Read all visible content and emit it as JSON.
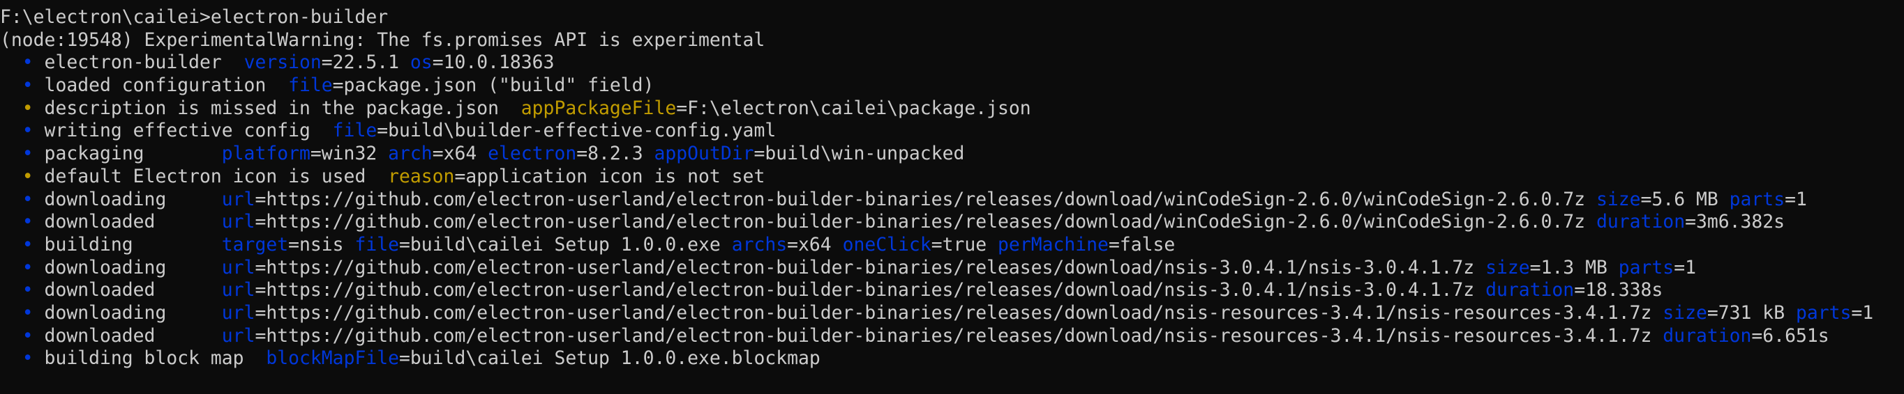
{
  "colors": {
    "background": "#0c0c0c",
    "fg": "#cccccc",
    "blue": "#0037da",
    "yellow": "#c19c00"
  },
  "terminal": {
    "lines": [
      [
        {
          "t": "F:\\electron\\cailei>electron-builder",
          "c": "fg"
        }
      ],
      [
        {
          "t": "(node:19548) ExperimentalWarning: The fs.promises API is experimental",
          "c": "fg"
        }
      ],
      [
        {
          "t": "  •",
          "c": "blue"
        },
        {
          "t": " electron-builder  ",
          "c": "fg"
        },
        {
          "t": "version",
          "c": "blue"
        },
        {
          "t": "=22.5.1 ",
          "c": "fg"
        },
        {
          "t": "os",
          "c": "blue"
        },
        {
          "t": "=10.0.18363",
          "c": "fg"
        }
      ],
      [
        {
          "t": "  •",
          "c": "blue"
        },
        {
          "t": " loaded configuration  ",
          "c": "fg"
        },
        {
          "t": "file",
          "c": "blue"
        },
        {
          "t": "=package.json (\"build\" field)",
          "c": "fg"
        }
      ],
      [
        {
          "t": "  •",
          "c": "yellow"
        },
        {
          "t": " description is missed in the package.json  ",
          "c": "fg"
        },
        {
          "t": "appPackageFile",
          "c": "yellow"
        },
        {
          "t": "=F:\\electron\\cailei\\package.json",
          "c": "fg"
        }
      ],
      [
        {
          "t": "  •",
          "c": "blue"
        },
        {
          "t": " writing effective config  ",
          "c": "fg"
        },
        {
          "t": "file",
          "c": "blue"
        },
        {
          "t": "=build\\builder-effective-config.yaml",
          "c": "fg"
        }
      ],
      [
        {
          "t": "  •",
          "c": "blue"
        },
        {
          "t": " packaging       ",
          "c": "fg"
        },
        {
          "t": "platform",
          "c": "blue"
        },
        {
          "t": "=win32 ",
          "c": "fg"
        },
        {
          "t": "arch",
          "c": "blue"
        },
        {
          "t": "=x64 ",
          "c": "fg"
        },
        {
          "t": "electron",
          "c": "blue"
        },
        {
          "t": "=8.2.3 ",
          "c": "fg"
        },
        {
          "t": "appOutDir",
          "c": "blue"
        },
        {
          "t": "=build\\win-unpacked",
          "c": "fg"
        }
      ],
      [
        {
          "t": "  •",
          "c": "yellow"
        },
        {
          "t": " default Electron icon is used  ",
          "c": "fg"
        },
        {
          "t": "reason",
          "c": "yellow"
        },
        {
          "t": "=application icon is not set",
          "c": "fg"
        }
      ],
      [
        {
          "t": "  •",
          "c": "blue"
        },
        {
          "t": " downloading     ",
          "c": "fg"
        },
        {
          "t": "url",
          "c": "blue"
        },
        {
          "t": "=https://github.com/electron-userland/electron-builder-binaries/releases/download/winCodeSign-2.6.0/winCodeSign-2.6.0.7z ",
          "c": "fg"
        },
        {
          "t": "size",
          "c": "blue"
        },
        {
          "t": "=5.6 MB ",
          "c": "fg"
        },
        {
          "t": "parts",
          "c": "blue"
        },
        {
          "t": "=1",
          "c": "fg"
        }
      ],
      [
        {
          "t": "  •",
          "c": "blue"
        },
        {
          "t": " downloaded      ",
          "c": "fg"
        },
        {
          "t": "url",
          "c": "blue"
        },
        {
          "t": "=https://github.com/electron-userland/electron-builder-binaries/releases/download/winCodeSign-2.6.0/winCodeSign-2.6.0.7z ",
          "c": "fg"
        },
        {
          "t": "duration",
          "c": "blue"
        },
        {
          "t": "=3m6.382s",
          "c": "fg"
        }
      ],
      [
        {
          "t": "  •",
          "c": "blue"
        },
        {
          "t": " building        ",
          "c": "fg"
        },
        {
          "t": "target",
          "c": "blue"
        },
        {
          "t": "=nsis ",
          "c": "fg"
        },
        {
          "t": "file",
          "c": "blue"
        },
        {
          "t": "=build\\cailei Setup 1.0.0.exe ",
          "c": "fg"
        },
        {
          "t": "archs",
          "c": "blue"
        },
        {
          "t": "=x64 ",
          "c": "fg"
        },
        {
          "t": "oneClick",
          "c": "blue"
        },
        {
          "t": "=true ",
          "c": "fg"
        },
        {
          "t": "perMachine",
          "c": "blue"
        },
        {
          "t": "=false",
          "c": "fg"
        }
      ],
      [
        {
          "t": "  •",
          "c": "blue"
        },
        {
          "t": " downloading     ",
          "c": "fg"
        },
        {
          "t": "url",
          "c": "blue"
        },
        {
          "t": "=https://github.com/electron-userland/electron-builder-binaries/releases/download/nsis-3.0.4.1/nsis-3.0.4.1.7z ",
          "c": "fg"
        },
        {
          "t": "size",
          "c": "blue"
        },
        {
          "t": "=1.3 MB ",
          "c": "fg"
        },
        {
          "t": "parts",
          "c": "blue"
        },
        {
          "t": "=1",
          "c": "fg"
        }
      ],
      [
        {
          "t": "  •",
          "c": "blue"
        },
        {
          "t": " downloaded      ",
          "c": "fg"
        },
        {
          "t": "url",
          "c": "blue"
        },
        {
          "t": "=https://github.com/electron-userland/electron-builder-binaries/releases/download/nsis-3.0.4.1/nsis-3.0.4.1.7z ",
          "c": "fg"
        },
        {
          "t": "duration",
          "c": "blue"
        },
        {
          "t": "=18.338s",
          "c": "fg"
        }
      ],
      [
        {
          "t": "  •",
          "c": "blue"
        },
        {
          "t": " downloading     ",
          "c": "fg"
        },
        {
          "t": "url",
          "c": "blue"
        },
        {
          "t": "=https://github.com/electron-userland/electron-builder-binaries/releases/download/nsis-resources-3.4.1/nsis-resources-3.4.1.7z ",
          "c": "fg"
        },
        {
          "t": "size",
          "c": "blue"
        },
        {
          "t": "=731 kB ",
          "c": "fg"
        },
        {
          "t": "parts",
          "c": "blue"
        },
        {
          "t": "=1",
          "c": "fg"
        }
      ],
      [
        {
          "t": "  •",
          "c": "blue"
        },
        {
          "t": " downloaded      ",
          "c": "fg"
        },
        {
          "t": "url",
          "c": "blue"
        },
        {
          "t": "=https://github.com/electron-userland/electron-builder-binaries/releases/download/nsis-resources-3.4.1/nsis-resources-3.4.1.7z ",
          "c": "fg"
        },
        {
          "t": "duration",
          "c": "blue"
        },
        {
          "t": "=6.651s",
          "c": "fg"
        }
      ],
      [
        {
          "t": "  •",
          "c": "blue"
        },
        {
          "t": " building block map  ",
          "c": "fg"
        },
        {
          "t": "blockMapFile",
          "c": "blue"
        },
        {
          "t": "=build\\cailei Setup 1.0.0.exe.blockmap",
          "c": "fg"
        }
      ]
    ]
  }
}
